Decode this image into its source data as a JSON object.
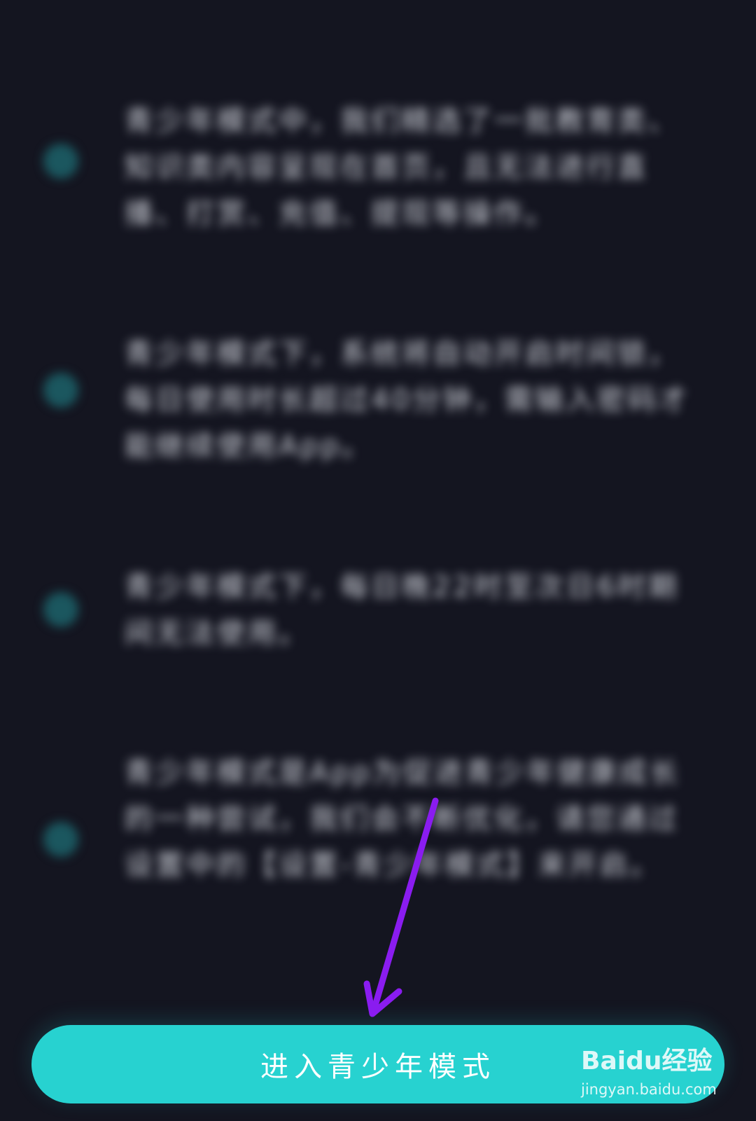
{
  "items": [
    {
      "text": "青少年模式中，我们精选了一批教育类、知识类内容呈现在首页，且无法进行直播、打赏、充值、提现等操作。"
    },
    {
      "text": "青少年模式下，系统将自动开启时间锁，每日使用时长超过40分钟，需输入密码才能继续使用App。"
    },
    {
      "text": "青少年模式下，每日晚22时至次日6时期间无法使用。"
    },
    {
      "text": "青少年模式是App为促进青少年健康成长的一种尝试，我们会不断优化，请您通过设置中的【设置-青少年模式】来开启。"
    }
  ],
  "button": {
    "label": "进入青少年模式"
  },
  "watermark": {
    "brand": "Baidu经验",
    "url": "jingyan.baidu.com"
  },
  "colors": {
    "background": "#141520",
    "accent": "#27d2d0",
    "arrow": "#8a1cf0"
  }
}
